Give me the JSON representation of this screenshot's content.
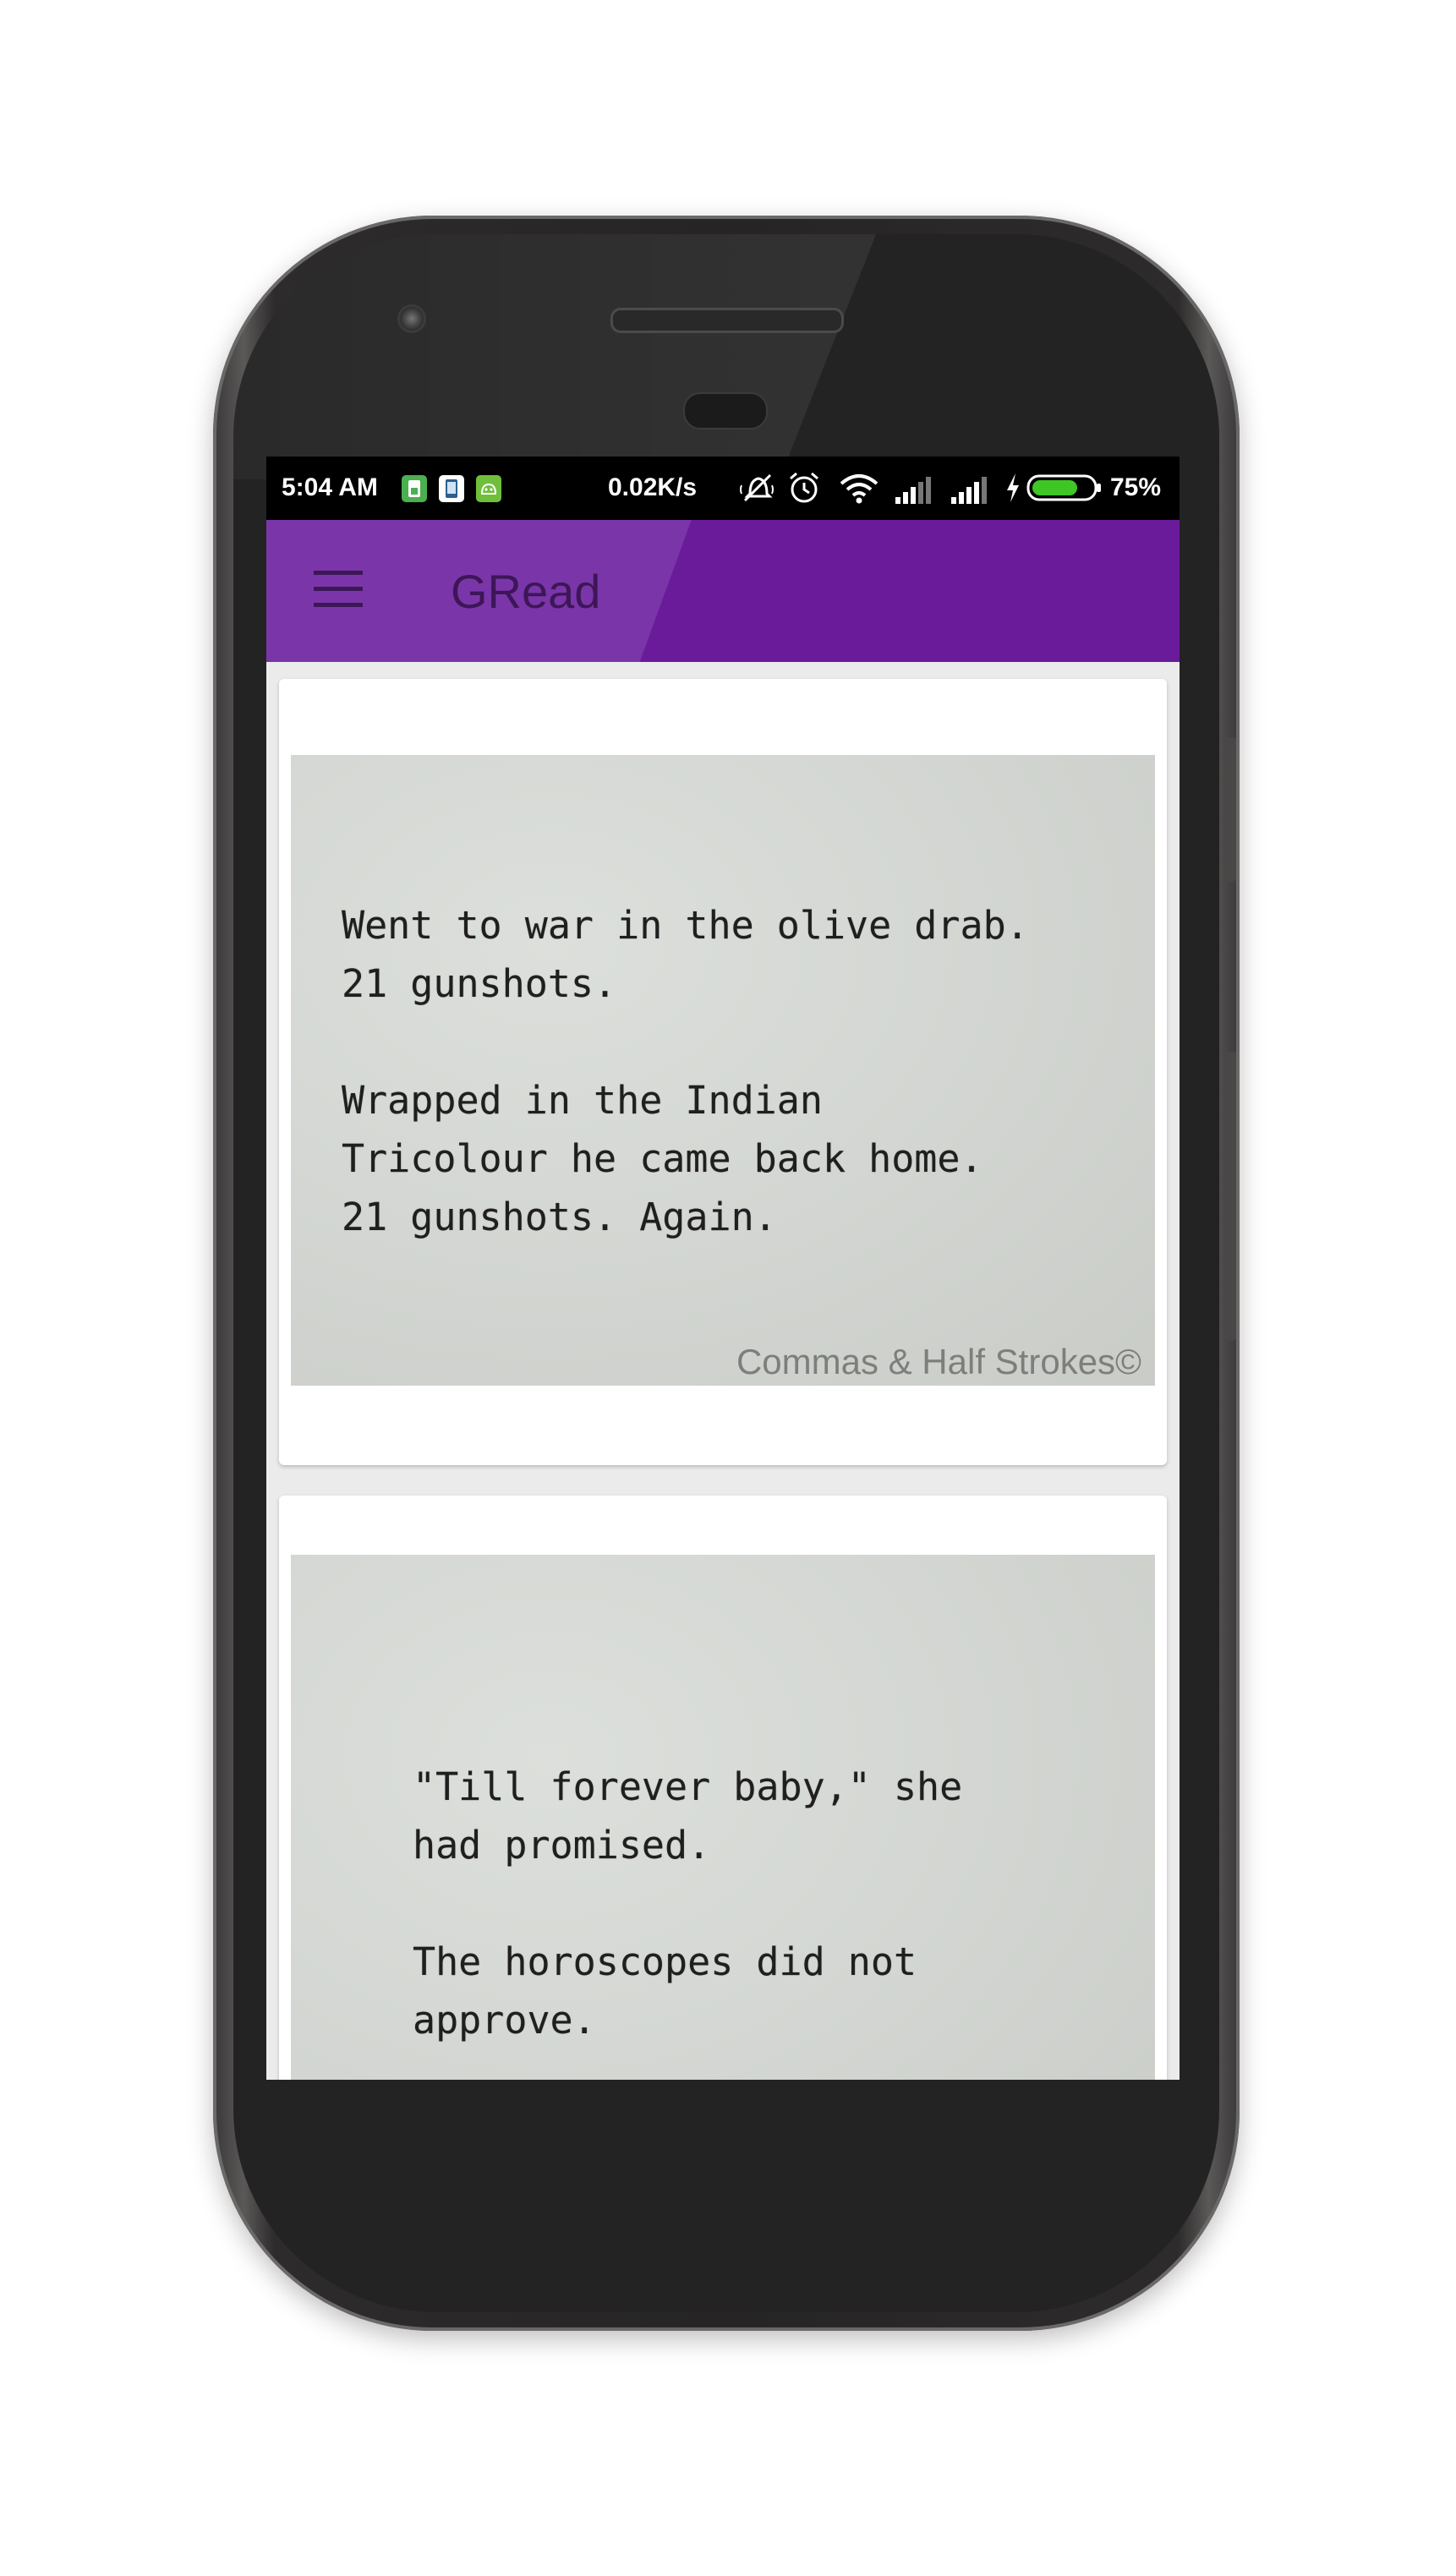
{
  "status_bar": {
    "time": "5:04 AM",
    "network_speed": "0.02K/s",
    "battery_percent": "75%",
    "battery_level": 0.75,
    "icons": [
      "sim-notification-icon",
      "phone-notification-icon",
      "android-notification-icon",
      "mute-vibrate-icon",
      "alarm-icon",
      "wifi-icon",
      "signal-icon",
      "signal-icon",
      "charging-icon",
      "battery-icon"
    ]
  },
  "app_bar": {
    "title": "GRead",
    "menu_icon": "hamburger-menu-icon",
    "colors": {
      "primary": "#6a1b9a",
      "primary_light": "#7a36a8",
      "title": "#3d1658"
    }
  },
  "feed": {
    "cards": [
      {
        "quote_text": "Went to war in the olive drab.\n21 gunshots.\n\nWrapped in the Indian\nTricolour he came back home.\n21 gunshots. Again.",
        "watermark": "Commas & Half Strokes©"
      },
      {
        "quote_text": "\"Till forever baby,\" she\nhad promised.\n\nThe horoscopes did not\napprove."
      }
    ]
  }
}
